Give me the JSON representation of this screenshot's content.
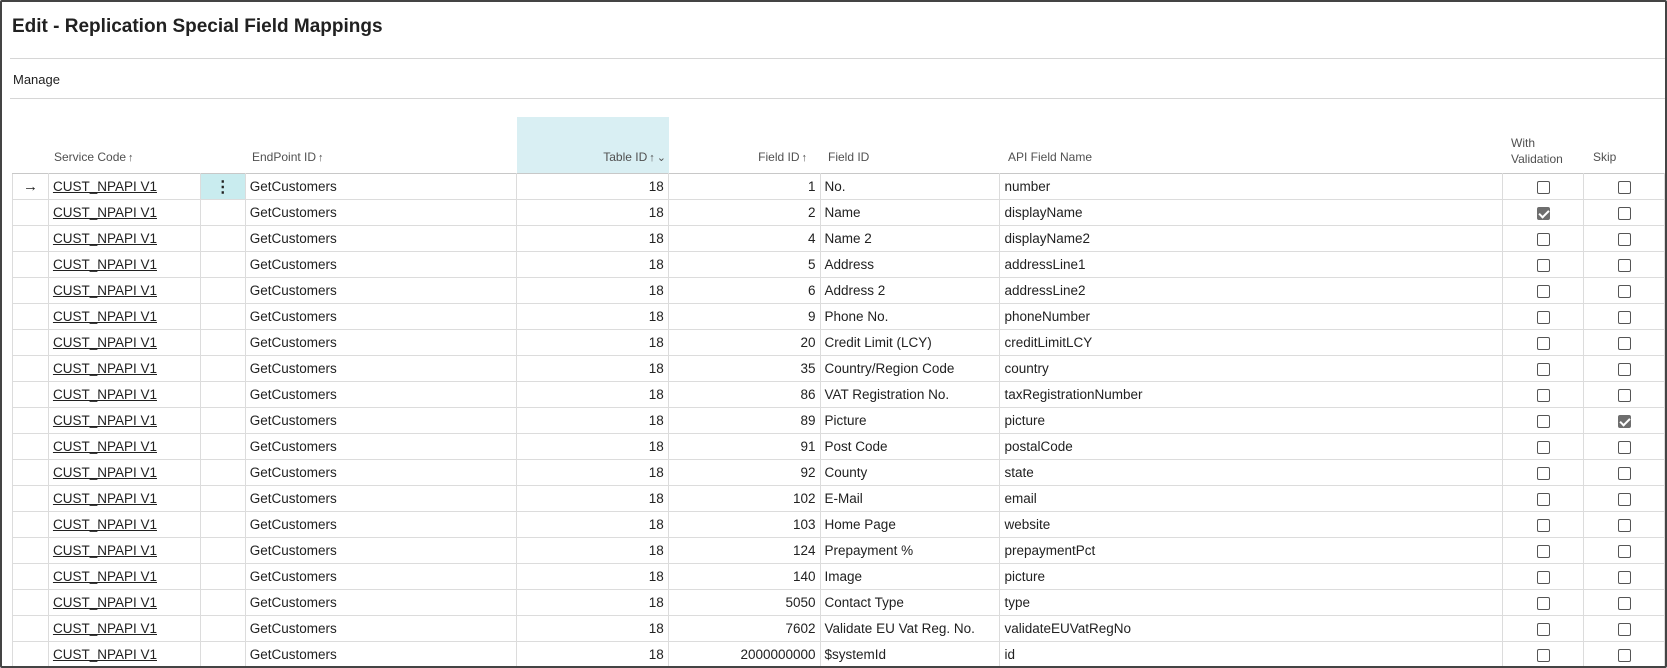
{
  "window": {
    "title": "Edit - Replication Special Field Mappings",
    "menu": {
      "manage_label": "Manage"
    }
  },
  "columns": {
    "service_code": "Service Code",
    "endpoint_id": "EndPoint ID",
    "table_id": "Table ID",
    "field_id_num": "Field ID",
    "field_id_name": "Field ID",
    "api_field_name": "API Field Name",
    "with_validation": "With\nValidation",
    "skip": "Skip",
    "sort_asc_glyph": "↑",
    "sort_desc_glyph": "↑",
    "chevron_glyph": "⌄"
  },
  "rows": [
    {
      "indicator": "→",
      "service_code": "CUST_NPAPI V1",
      "endpoint_id": "GetCustomers",
      "table_id": "18",
      "field_id": "1",
      "field_name": "No.",
      "api_field_name": "number",
      "with_validation": false,
      "skip": false,
      "selected": true
    },
    {
      "indicator": "",
      "service_code": "CUST_NPAPI V1",
      "endpoint_id": "GetCustomers",
      "table_id": "18",
      "field_id": "2",
      "field_name": "Name",
      "api_field_name": "displayName",
      "with_validation": true,
      "skip": false
    },
    {
      "indicator": "",
      "service_code": "CUST_NPAPI V1",
      "endpoint_id": "GetCustomers",
      "table_id": "18",
      "field_id": "4",
      "field_name": "Name 2",
      "api_field_name": "displayName2",
      "with_validation": false,
      "skip": false
    },
    {
      "indicator": "",
      "service_code": "CUST_NPAPI V1",
      "endpoint_id": "GetCustomers",
      "table_id": "18",
      "field_id": "5",
      "field_name": "Address",
      "api_field_name": "addressLine1",
      "with_validation": false,
      "skip": false
    },
    {
      "indicator": "",
      "service_code": "CUST_NPAPI V1",
      "endpoint_id": "GetCustomers",
      "table_id": "18",
      "field_id": "6",
      "field_name": "Address 2",
      "api_field_name": "addressLine2",
      "with_validation": false,
      "skip": false
    },
    {
      "indicator": "",
      "service_code": "CUST_NPAPI V1",
      "endpoint_id": "GetCustomers",
      "table_id": "18",
      "field_id": "9",
      "field_name": "Phone No.",
      "api_field_name": "phoneNumber",
      "with_validation": false,
      "skip": false
    },
    {
      "indicator": "",
      "service_code": "CUST_NPAPI V1",
      "endpoint_id": "GetCustomers",
      "table_id": "18",
      "field_id": "20",
      "field_name": "Credit Limit (LCY)",
      "api_field_name": "creditLimitLCY",
      "with_validation": false,
      "skip": false
    },
    {
      "indicator": "",
      "service_code": "CUST_NPAPI V1",
      "endpoint_id": "GetCustomers",
      "table_id": "18",
      "field_id": "35",
      "field_name": "Country/Region Code",
      "api_field_name": "country",
      "with_validation": false,
      "skip": false
    },
    {
      "indicator": "",
      "service_code": "CUST_NPAPI V1",
      "endpoint_id": "GetCustomers",
      "table_id": "18",
      "field_id": "86",
      "field_name": "VAT Registration No.",
      "api_field_name": "taxRegistrationNumber",
      "with_validation": false,
      "skip": false
    },
    {
      "indicator": "",
      "service_code": "CUST_NPAPI V1",
      "endpoint_id": "GetCustomers",
      "table_id": "18",
      "field_id": "89",
      "field_name": "Picture",
      "api_field_name": "picture",
      "with_validation": false,
      "skip": true
    },
    {
      "indicator": "",
      "service_code": "CUST_NPAPI V1",
      "endpoint_id": "GetCustomers",
      "table_id": "18",
      "field_id": "91",
      "field_name": "Post Code",
      "api_field_name": "postalCode",
      "with_validation": false,
      "skip": false
    },
    {
      "indicator": "",
      "service_code": "CUST_NPAPI V1",
      "endpoint_id": "GetCustomers",
      "table_id": "18",
      "field_id": "92",
      "field_name": "County",
      "api_field_name": "state",
      "with_validation": false,
      "skip": false
    },
    {
      "indicator": "",
      "service_code": "CUST_NPAPI V1",
      "endpoint_id": "GetCustomers",
      "table_id": "18",
      "field_id": "102",
      "field_name": "E-Mail",
      "api_field_name": "email",
      "with_validation": false,
      "skip": false
    },
    {
      "indicator": "",
      "service_code": "CUST_NPAPI V1",
      "endpoint_id": "GetCustomers",
      "table_id": "18",
      "field_id": "103",
      "field_name": "Home Page",
      "api_field_name": "website",
      "with_validation": false,
      "skip": false
    },
    {
      "indicator": "",
      "service_code": "CUST_NPAPI V1",
      "endpoint_id": "GetCustomers",
      "table_id": "18",
      "field_id": "124",
      "field_name": "Prepayment %",
      "api_field_name": "prepaymentPct",
      "with_validation": false,
      "skip": false
    },
    {
      "indicator": "",
      "service_code": "CUST_NPAPI V1",
      "endpoint_id": "GetCustomers",
      "table_id": "18",
      "field_id": "140",
      "field_name": "Image",
      "api_field_name": "picture",
      "with_validation": false,
      "skip": false
    },
    {
      "indicator": "",
      "service_code": "CUST_NPAPI V1",
      "endpoint_id": "GetCustomers",
      "table_id": "18",
      "field_id": "5050",
      "field_name": "Contact Type",
      "api_field_name": "type",
      "with_validation": false,
      "skip": false
    },
    {
      "indicator": "",
      "service_code": "CUST_NPAPI V1",
      "endpoint_id": "GetCustomers",
      "table_id": "18",
      "field_id": "7602",
      "field_name": "Validate EU Vat Reg. No.",
      "api_field_name": "validateEUVatRegNo",
      "with_validation": false,
      "skip": false
    },
    {
      "indicator": "",
      "service_code": "CUST_NPAPI V1",
      "endpoint_id": "GetCustomers",
      "table_id": "18",
      "field_id": "2000000000",
      "field_name": "$systemId",
      "api_field_name": "id",
      "with_validation": false,
      "skip": false
    }
  ],
  "row_action_glyph": "⋮",
  "colors": {
    "accent_highlight": "#d9eff3",
    "active_cell": "#c9ecef"
  }
}
